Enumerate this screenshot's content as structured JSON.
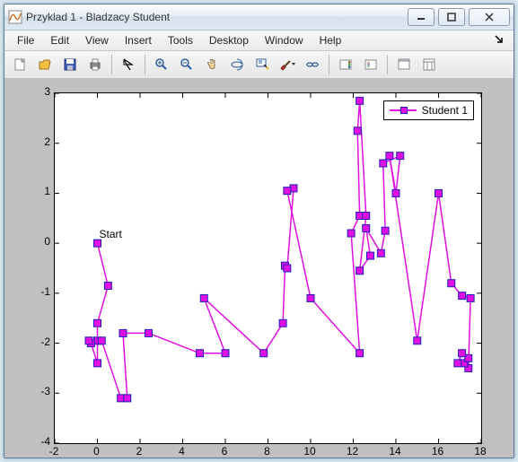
{
  "window": {
    "title": "Przyklad 1 - Bladzacy Student"
  },
  "menu": {
    "items": [
      "File",
      "Edit",
      "View",
      "Insert",
      "Tools",
      "Desktop",
      "Window",
      "Help"
    ],
    "right_glyph": "↘"
  },
  "toolbar": {
    "icons": [
      "new",
      "open",
      "save",
      "print",
      "arrow",
      "zoom-in",
      "zoom-out",
      "pan",
      "rotate3d",
      "datacursor",
      "brush",
      "link",
      "colorbar",
      "legend",
      "dock",
      "undock"
    ]
  },
  "chart_data": {
    "type": "line",
    "title": "",
    "xlabel": "",
    "ylabel": "",
    "xlim": [
      -2,
      18
    ],
    "ylim": [
      -4,
      3
    ],
    "x_ticks": [
      -2,
      0,
      2,
      4,
      6,
      8,
      10,
      12,
      14,
      16,
      18
    ],
    "y_ticks": [
      -4,
      -3,
      -2,
      -1,
      0,
      1,
      2,
      3
    ],
    "legend": {
      "entries": [
        "Student 1"
      ],
      "position": "top-right"
    },
    "annotations": [
      {
        "text": "Start",
        "x": 0,
        "y": 0.05
      }
    ],
    "series": [
      {
        "name": "Student 1",
        "color": "#e010e0",
        "marker": "square",
        "x": [
          0,
          0.5,
          0,
          0,
          0,
          -0.3,
          -0.4,
          0.2,
          1.1,
          1.4,
          1.2,
          2.4,
          4.8,
          6.0,
          5.0,
          7.8,
          8.7,
          8.8,
          8.9,
          9.2,
          8.9,
          10.0,
          12.3,
          11.9,
          12.3,
          12.2,
          12.3,
          12.6,
          12.3,
          12.8,
          12.6,
          13.3,
          13.5,
          13.4,
          14.2,
          14.0,
          13.7,
          15.0,
          16.0,
          16.6,
          17.1,
          17.5,
          17.4,
          17.2,
          17.4,
          17.1,
          16.9
        ],
        "y": [
          0.0,
          -0.85,
          -1.6,
          -1.95,
          -2.4,
          -2.0,
          -1.95,
          -1.95,
          -3.1,
          -3.1,
          -1.8,
          -1.8,
          -2.2,
          -2.2,
          -1.1,
          -2.2,
          -1.6,
          -0.45,
          -0.5,
          1.1,
          1.05,
          -1.1,
          -2.2,
          0.2,
          0.55,
          2.25,
          2.85,
          0.55,
          -0.55,
          -0.25,
          0.3,
          -0.2,
          0.25,
          1.6,
          1.75,
          1.0,
          1.75,
          -1.95,
          1.0,
          -0.8,
          -1.05,
          -1.1,
          -2.5,
          -2.4,
          -2.3,
          -2.2,
          -2.4
        ]
      }
    ]
  }
}
